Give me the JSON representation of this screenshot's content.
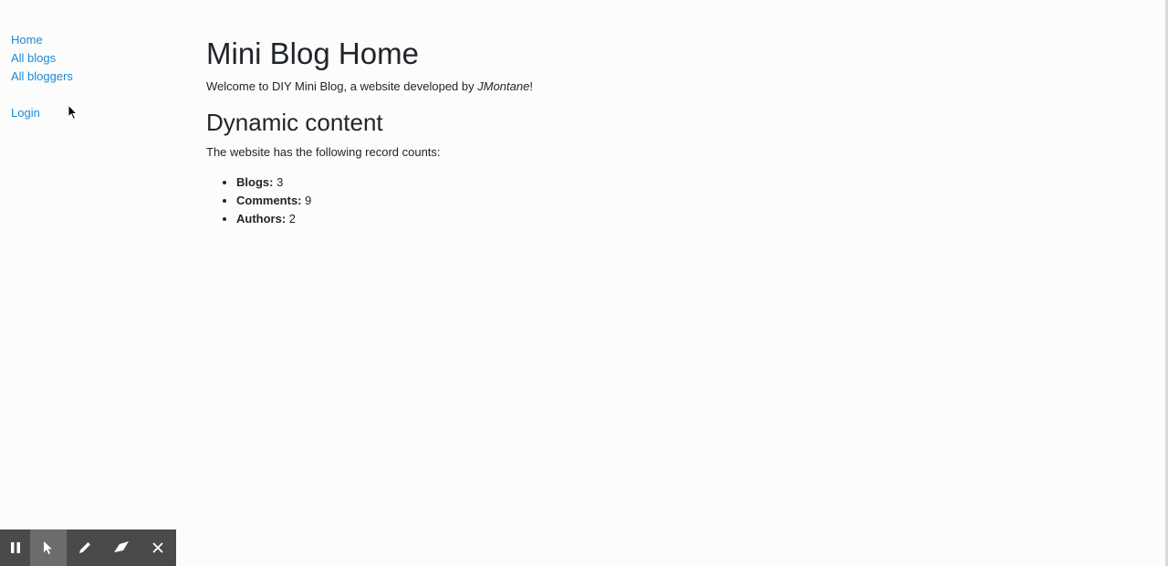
{
  "sidebar": {
    "links": [
      {
        "label": "Home"
      },
      {
        "label": "All blogs"
      },
      {
        "label": "All bloggers"
      }
    ],
    "login_label": "Login"
  },
  "main": {
    "title": "Mini Blog Home",
    "welcome_prefix": "Welcome to DIY Mini Blog, a website developed by ",
    "welcome_author": "JMontane",
    "welcome_suffix": "!",
    "section_title": "Dynamic content",
    "record_intro": "The website has the following record counts:",
    "counts": [
      {
        "label": "Blogs:",
        "value": "3"
      },
      {
        "label": "Comments:",
        "value": "9"
      },
      {
        "label": "Authors:",
        "value": "2"
      }
    ]
  },
  "toolbar": {
    "tools": [
      {
        "icon": "pause-icon"
      },
      {
        "icon": "pointer-icon",
        "active": true
      },
      {
        "icon": "pen-icon"
      },
      {
        "icon": "eraser-icon"
      },
      {
        "icon": "close-icon"
      }
    ]
  },
  "colors": {
    "link": "#1a8bd6",
    "text": "#212529",
    "background": "#fcfcfc",
    "toolbar": "#4a4a4a",
    "toolbar_active": "#6c6c6c"
  }
}
